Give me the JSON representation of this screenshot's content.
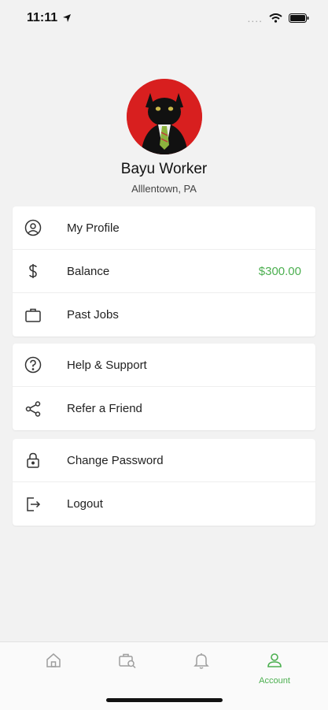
{
  "status_bar": {
    "time": "11:11",
    "signal": "....",
    "icons": [
      "location-arrow-icon",
      "wifi-icon",
      "battery-icon"
    ]
  },
  "profile": {
    "name": "Bayu Worker",
    "location": "Alllentown, PA",
    "avatar_bg_color": "#d81f1f"
  },
  "menu_groups": [
    {
      "items": [
        {
          "label": "My Profile",
          "icon": "user-circle-icon"
        },
        {
          "label": "Balance",
          "icon": "dollar-icon",
          "value": "$300.00"
        },
        {
          "label": "Past Jobs",
          "icon": "briefcase-icon"
        }
      ]
    },
    {
      "items": [
        {
          "label": "Help & Support",
          "icon": "help-circle-icon"
        },
        {
          "label": "Refer a Friend",
          "icon": "share-icon"
        }
      ]
    },
    {
      "items": [
        {
          "label": "Change Password",
          "icon": "lock-icon"
        },
        {
          "label": "Logout",
          "icon": "logout-icon"
        }
      ]
    }
  ],
  "tab_bar": {
    "tabs": [
      {
        "icon": "home-icon",
        "active": false
      },
      {
        "icon": "job-search-icon",
        "active": false
      },
      {
        "icon": "bell-icon",
        "active": false
      },
      {
        "icon": "account-icon",
        "label": "Account",
        "active": true
      }
    ]
  },
  "colors": {
    "accent": "#4caf50",
    "background": "#f2f2f2",
    "icon_inactive": "#9e9e9e"
  }
}
